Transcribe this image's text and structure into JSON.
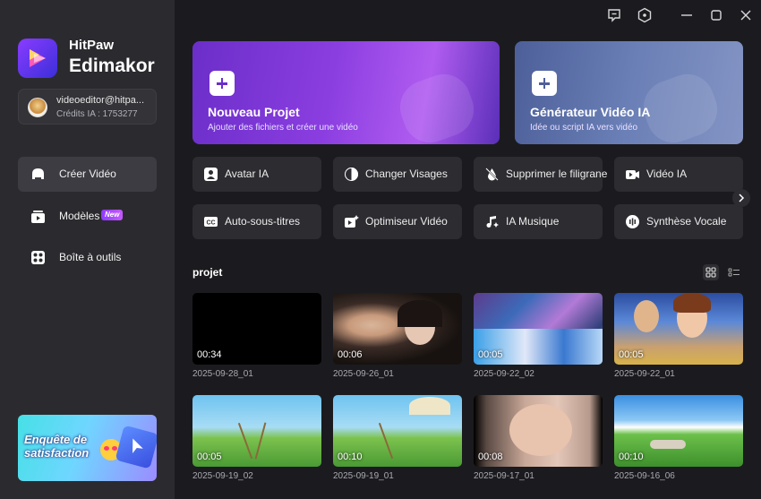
{
  "app": {
    "brand_small": "HitPaw",
    "brand_large": "Edimakor"
  },
  "account": {
    "email": "videoeditor@hitpa...",
    "credits": "Crédits IA : 1753277"
  },
  "sidebar": {
    "items": [
      {
        "label": "Créer Vidéo",
        "icon": "video-create-icon",
        "active": true
      },
      {
        "label": "Modèles",
        "icon": "template-icon",
        "badge": "New"
      },
      {
        "label": "Boîte à outils",
        "icon": "toolbox-icon"
      }
    ],
    "survey": {
      "text": "Enquête de satisfaction"
    }
  },
  "hero": {
    "new_project": {
      "title": "Nouveau Projet",
      "subtitle": "Ajouter des fichiers et créer une vidéo"
    },
    "ai_video": {
      "title": "Générateur Vidéo IA",
      "subtitle": "Idée ou script IA vers vidéo"
    }
  },
  "tools": [
    {
      "label": "Avatar IA",
      "icon": "avatar-icon"
    },
    {
      "label": "Changer Visages",
      "icon": "face-swap-icon"
    },
    {
      "label": "Supprimer le filigrane",
      "icon": "watermark-remove-icon"
    },
    {
      "label": "Vidéo IA",
      "icon": "ai-video-icon"
    },
    {
      "label": "Auto-sous-titres",
      "icon": "subtitles-icon"
    },
    {
      "label": "Optimiseur Vidéo",
      "icon": "video-enhance-icon"
    },
    {
      "label": "IA Musique",
      "icon": "music-icon"
    },
    {
      "label": "Synthèse Vocale",
      "icon": "tts-icon"
    }
  ],
  "projects": {
    "title": "projet",
    "items": [
      {
        "duration": "00:34",
        "date": "2025-09-28_01"
      },
      {
        "duration": "00:06",
        "date": "2025-09-26_01"
      },
      {
        "duration": "00:05",
        "date": "2025-09-22_02"
      },
      {
        "duration": "00:05",
        "date": "2025-09-22_01"
      },
      {
        "duration": "00:05",
        "date": "2025-09-19_02"
      },
      {
        "duration": "00:10",
        "date": "2025-09-19_01"
      },
      {
        "duration": "00:08",
        "date": "2025-09-17_01"
      },
      {
        "duration": "00:10",
        "date": "2025-09-16_06"
      }
    ]
  },
  "colors": {
    "accent": "#8a3cff",
    "sidebar_bg": "#2b2b2f",
    "main_bg": "#1b1b1f"
  }
}
